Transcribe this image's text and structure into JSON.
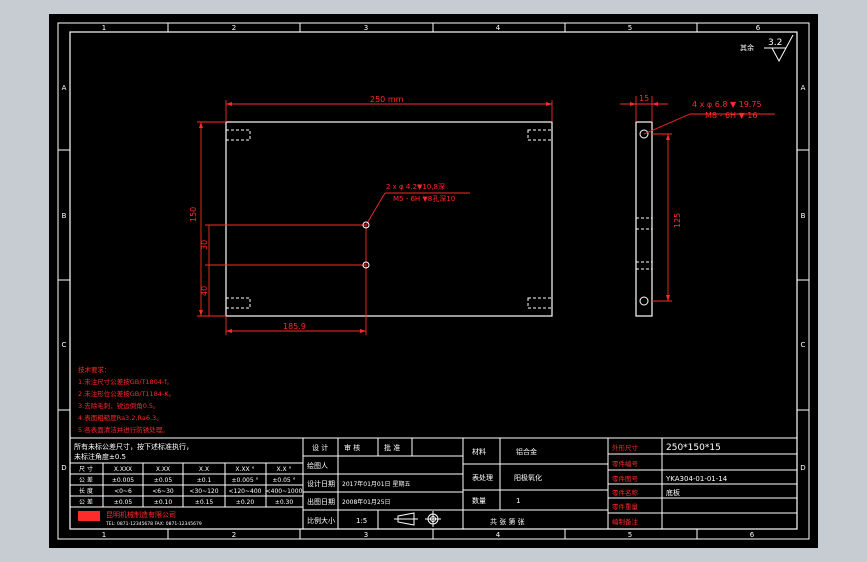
{
  "colors": {
    "background": "#c7ccd3",
    "paper": "#000000",
    "frame": "#ffffff",
    "dimension": "#ff2a2a",
    "text": "#ffffff"
  },
  "zone_labels": {
    "top": [
      "1",
      "2",
      "3",
      "4",
      "5",
      "6"
    ],
    "bottom": [
      "1",
      "2",
      "3",
      "4",
      "5",
      "6"
    ],
    "left": [
      "A",
      "B",
      "C",
      "D"
    ],
    "right": [
      "A",
      "B",
      "C",
      "D"
    ]
  },
  "roughness": {
    "label": "其余",
    "value": "3.2"
  },
  "front_view": {
    "dim_width": "250 mm",
    "dim_height": "150",
    "dim_30": "30",
    "dim_40": "40",
    "dim_185": "185.9",
    "callout_line1": "2 x φ  4.2▼10,8深",
    "callout_line2": "M5 - 6H ▼8孔深10"
  },
  "side_view": {
    "dim_15": "15",
    "dim_125": "125",
    "callout_line1": "4 x φ  6.8 ▼ 19.75",
    "callout_line2": "M8 - 6H ▼ 16"
  },
  "notes": {
    "title": "技术要求：",
    "lines": [
      "1.未注尺寸公差按GB/T1804-f。",
      "2.未注形位公差按GB/T1184-K。",
      "3.去除毛刺，锐边倒角0.5。",
      "4.表面粗糙度Ra3.2,Ra6.3。",
      "5.各表面清洁并进行防锈处理。"
    ]
  },
  "tolerance_table": {
    "header_line1": "所有未标公差尺寸，按下述标准执行，",
    "header_line2": "未标注角度±0.5",
    "rows": [
      [
        "尺 寸",
        "X.XXX",
        "X.XX",
        "X.X",
        "X.XX °",
        "X.X °"
      ],
      [
        "公 差",
        "±0.005",
        "±0.05",
        "±0.1",
        "±0.005 °",
        "±0.05 °"
      ],
      [
        "长 度",
        "<0~6",
        "<6~30",
        "<30~120",
        "<120~400",
        "<400~1000"
      ],
      [
        "公 差",
        "±0.05",
        "±0.10",
        "±0.15",
        "±0.20",
        "±0.30"
      ]
    ],
    "company": "昆明机械制造有限公司",
    "company_sub": "TEL: 0871-12345678  FAX: 0871-12345679"
  },
  "title_block": {
    "design": "设 计",
    "review": "审 核",
    "approve": "批 准",
    "designer_label": "绘图人",
    "design_date_label": "设计日期",
    "design_date": "2017年01月01日 星期五",
    "print_date_label": "出图日期",
    "print_date": "2008年01月25日",
    "scale_label": "比例大小",
    "scale": "1:5",
    "material_label": "材料",
    "material": "铝合金",
    "surface_label": "表处理",
    "surface": "阳极氧化",
    "qty_label": "数量",
    "qty": "1",
    "sheet": "共 张  第 张",
    "dims_label": "外形尺寸",
    "dims": "250*150*15",
    "part_code_label": "零件编号",
    "part_name_label": "零件名称",
    "part_no_label": "零件图号",
    "part_no": "YKA304-01-01-14",
    "part_name": "底板",
    "weight_label": "零件重量",
    "notes_label": "编制备注"
  }
}
